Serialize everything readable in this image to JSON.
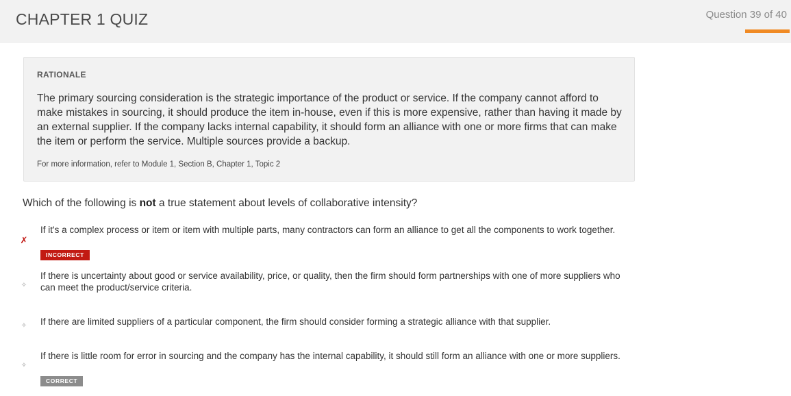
{
  "header": {
    "title": "CHAPTER 1 QUIZ",
    "question_counter": "Question 39 of 40",
    "progress_fraction": 0.975,
    "accent_color": "#f08a24"
  },
  "rationale": {
    "heading": "RATIONALE",
    "text": "The primary sourcing consideration is the strategic importance of the product or service. If the company cannot afford to make mistakes in sourcing, it should produce the item in-house, even if this is more expensive, rather than having it made by an external supplier. If the company lacks internal capability, it should form an alliance with one or more firms that can make the item or perform the service. Multiple sources provide a backup.",
    "reference": "For more information, refer to Module 1, Section B, Chapter 1, Topic 2"
  },
  "question": {
    "prefix": "Which of the following is ",
    "emphasis": "not",
    "suffix": " a true statement about levels of collaborative intensity?"
  },
  "answers": [
    {
      "text": "If it's a complex process or item or item with multiple parts, many contractors can form an alliance to get all the components to work together.",
      "marker": "✗",
      "badge": "INCORRECT"
    },
    {
      "text": "If there is uncertainty about good or service availability, price, or quality, then the firm should form partnerships with one of more suppliers who can meet the product/service criteria.",
      "marker": "✧"
    },
    {
      "text": "If there are limited suppliers of a particular component, the firm should consider forming a strategic alliance with that supplier.",
      "marker": "✧"
    },
    {
      "text": "If there is little room for error in sourcing and the company has the internal capability, it should still form an alliance with one or more suppliers.",
      "marker": "✧",
      "badge": "CORRECT"
    }
  ],
  "colors": {
    "incorrect": "#c21a12",
    "correct": "#8c8c8c"
  }
}
